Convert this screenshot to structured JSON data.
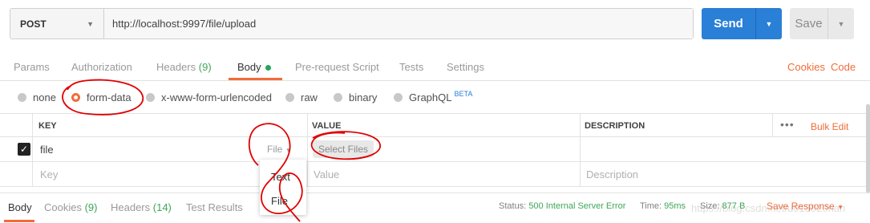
{
  "request": {
    "method": "POST",
    "url": "http://localhost:9997/file/upload",
    "send_label": "Send",
    "save_label": "Save"
  },
  "tabs": {
    "params": "Params",
    "authorization": "Authorization",
    "headers": "Headers",
    "headers_count": "(9)",
    "body": "Body",
    "prerequest": "Pre-request Script",
    "tests": "Tests",
    "settings": "Settings",
    "cookies": "Cookies",
    "code": "Code"
  },
  "body_types": {
    "none": "none",
    "form_data": "form-data",
    "urlencoded": "x-www-form-urlencoded",
    "raw": "raw",
    "binary": "binary",
    "graphql": "GraphQL",
    "graphql_badge": "BETA",
    "selected": "form-data"
  },
  "table": {
    "key_header": "KEY",
    "value_header": "VALUE",
    "description_header": "DESCRIPTION",
    "bulk_edit": "Bulk Edit",
    "row1": {
      "key": "file",
      "type": "File",
      "value_button": "Select Files",
      "checked": true
    },
    "empty_row": {
      "key_placeholder": "Key",
      "value_placeholder": "Value",
      "description_placeholder": "Description"
    }
  },
  "type_dropdown": {
    "options": [
      "Text",
      "File"
    ]
  },
  "response": {
    "tab_body": "Body",
    "tab_cookies": "Cookies",
    "cookies_count": "(9)",
    "tab_headers": "Headers",
    "headers_count": "(14)",
    "tab_tests": "Test Results",
    "status_label": "Status:",
    "status_value": "500 Internal Server Error",
    "time_label": "Time:",
    "time_value": "95ms",
    "size_label": "Size:",
    "size_value": "877 B",
    "save_response": "Save Response"
  },
  "watermark": "https://blog.csdn.net/u013020nah",
  "colors": {
    "accent": "#f26b3a",
    "primary": "#2a7fd6",
    "success": "#3fa657",
    "annotation": "#e00000"
  }
}
